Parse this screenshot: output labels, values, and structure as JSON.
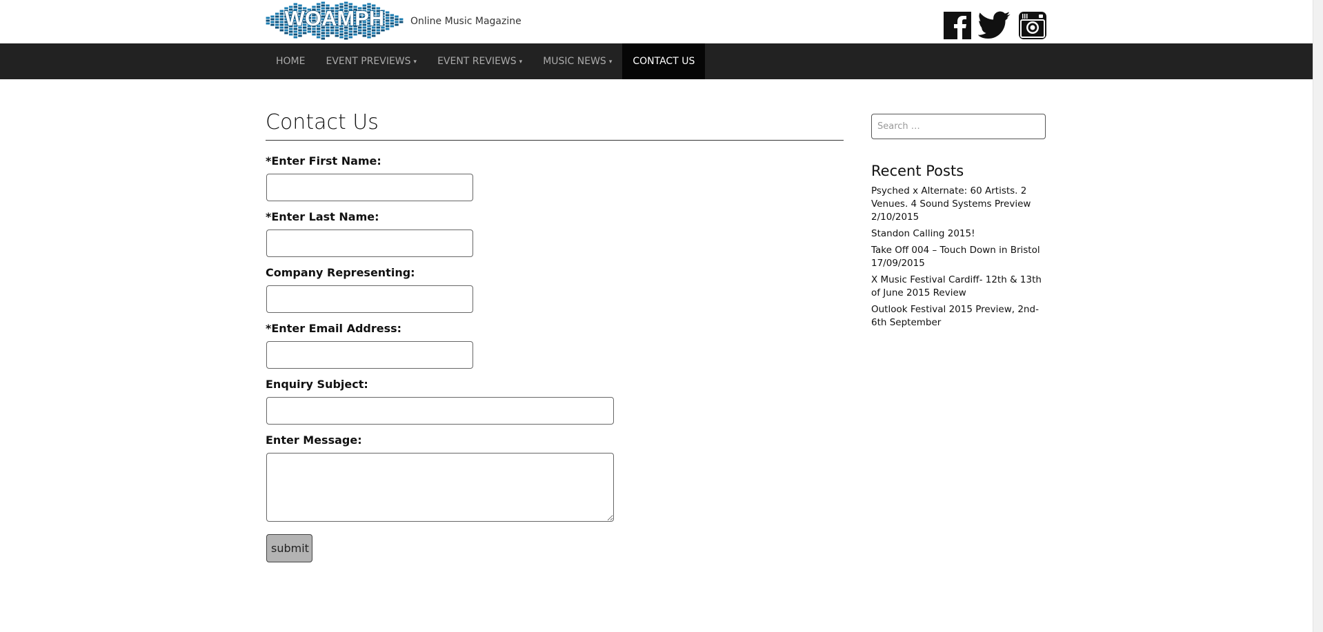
{
  "site": {
    "logo_text": "WOAMPH",
    "tagline": "Online Music Magazine"
  },
  "social": [
    {
      "name": "facebook-icon"
    },
    {
      "name": "twitter-icon"
    },
    {
      "name": "instagram-icon"
    }
  ],
  "nav": {
    "items": [
      {
        "label": "HOME",
        "caret": ""
      },
      {
        "label": "EVENT PREVIEWS",
        "caret": "▾"
      },
      {
        "label": "EVENT REVIEWS",
        "caret": "▾"
      },
      {
        "label": "MUSIC NEWS",
        "caret": "▾"
      },
      {
        "label": "CONTACT US",
        "caret": "",
        "active": true
      }
    ]
  },
  "main": {
    "title": "Contact Us",
    "fields": {
      "first_name": {
        "label": "*Enter First Name:",
        "value": ""
      },
      "last_name": {
        "label": "*Enter Last Name:",
        "value": ""
      },
      "company": {
        "label": "Company Representing:",
        "value": ""
      },
      "email": {
        "label": "*Enter Email Address:",
        "value": ""
      },
      "subject": {
        "label": "Enquiry Subject:",
        "value": ""
      },
      "message": {
        "label": "Enter Message:",
        "value": ""
      }
    },
    "submit_label": "submit"
  },
  "sidebar": {
    "search": {
      "placeholder": "Search …"
    },
    "recent_title": "Recent Posts",
    "recent_posts": [
      "Psyched x Alternate: 60 Artists. 2 Venues. 4 Sound Systems Preview 2/10/2015",
      "Standon Calling 2015!",
      "Take Off 004 – Touch Down in Bristol 17/09/2015",
      "X Music Festival Cardiff- 12th & 13th of June 2015 Review",
      "Outlook Festival 2015 Preview, 2nd-6th September"
    ]
  },
  "colors": {
    "navbar": "#222222",
    "nav_active": "#060606",
    "logo_blue": "#1a7bb0",
    "logo_dark": "#0f4f78"
  }
}
